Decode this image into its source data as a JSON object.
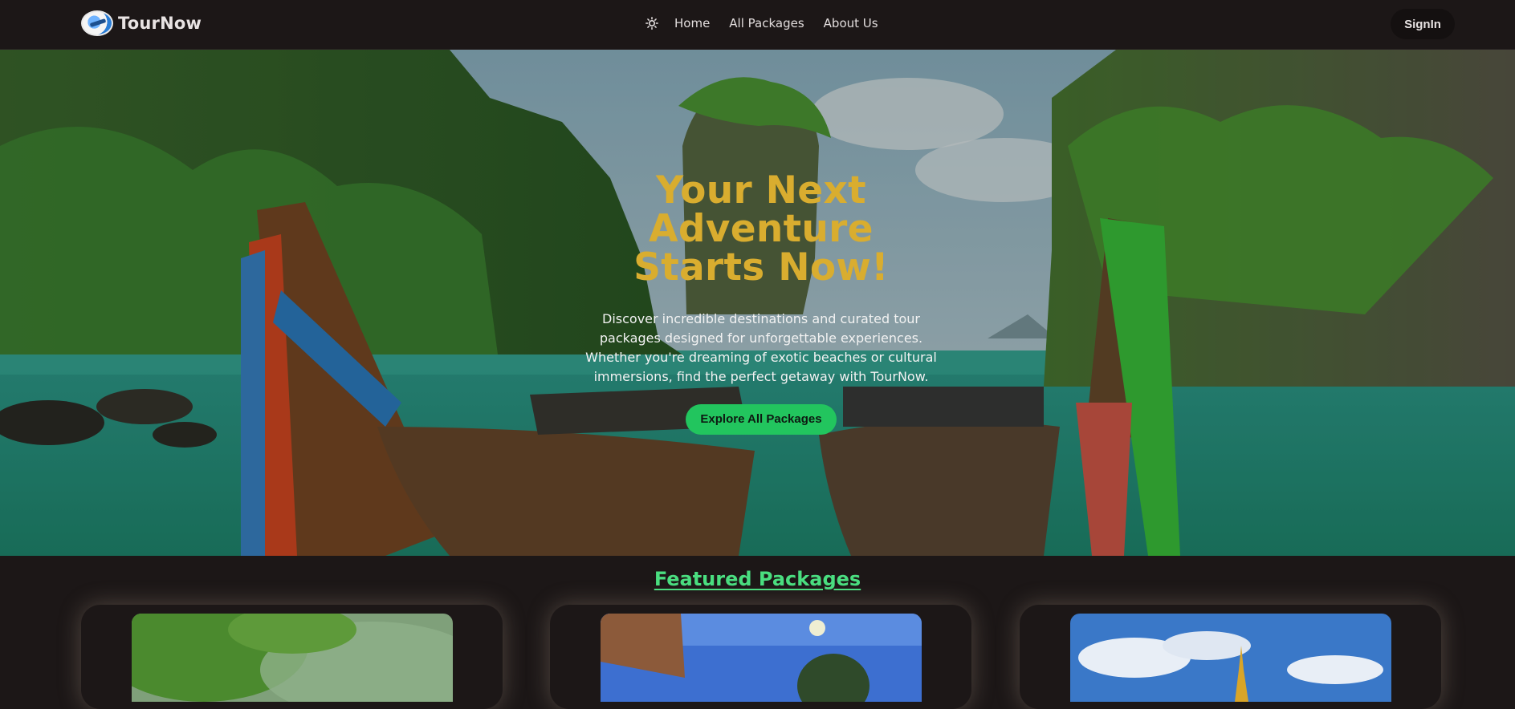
{
  "app": {
    "name": "TourNow"
  },
  "nav": {
    "theme_icon": "sun-icon",
    "links": [
      "Home",
      "All Packages",
      "About Us"
    ],
    "signin_label": "SignIn"
  },
  "hero": {
    "title": "Your Next Adventure Starts Now!",
    "description": "Discover incredible destinations and curated tour packages designed for unforgettable experiences. Whether you're dreaming of exotic beaches or cultural immersions, find the perfect getaway with TourNow.",
    "cta_label": "Explore All Packages"
  },
  "featured": {
    "title": "Featured Packages"
  },
  "colors": {
    "accent_green": "#22c55e",
    "title_gold": "#d9ad2f",
    "featured_green": "#4ade80",
    "background": "#1c1717"
  }
}
